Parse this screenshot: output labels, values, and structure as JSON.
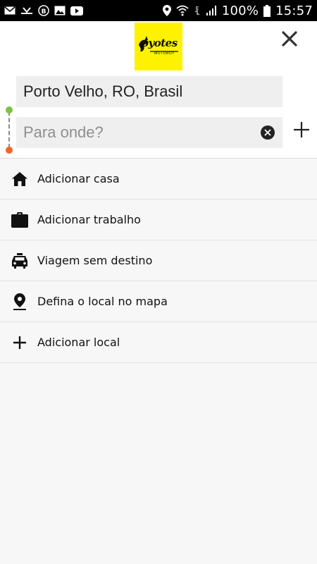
{
  "status_bar": {
    "battery": "100%",
    "time": "15:57",
    "icons": [
      "email-icon",
      "voicemail-icon",
      "b-app-icon",
      "image-icon",
      "youtube-icon",
      "location-icon",
      "wifi-icon",
      "edge-icon",
      "signal-icon",
      "battery-icon"
    ]
  },
  "header": {
    "logo_word": "oyotes",
    "logo_sub": "MOTOBOY",
    "origin_value": "Porto Velho, RO, Brasil",
    "destination_placeholder": "Para onde?",
    "colors": {
      "logo_bg": "#fff200",
      "origin_dot": "#7dc242",
      "destination_dot": "#f26522"
    }
  },
  "list": [
    {
      "label": "Adicionar casa",
      "icon": "home-icon"
    },
    {
      "label": "Adicionar trabalho",
      "icon": "briefcase-icon"
    },
    {
      "label": "Viagem sem destino",
      "icon": "taxi-icon"
    },
    {
      "label": "Defina o local no mapa",
      "icon": "map-pin-icon"
    },
    {
      "label": "Adicionar local",
      "icon": "plus-icon"
    }
  ]
}
